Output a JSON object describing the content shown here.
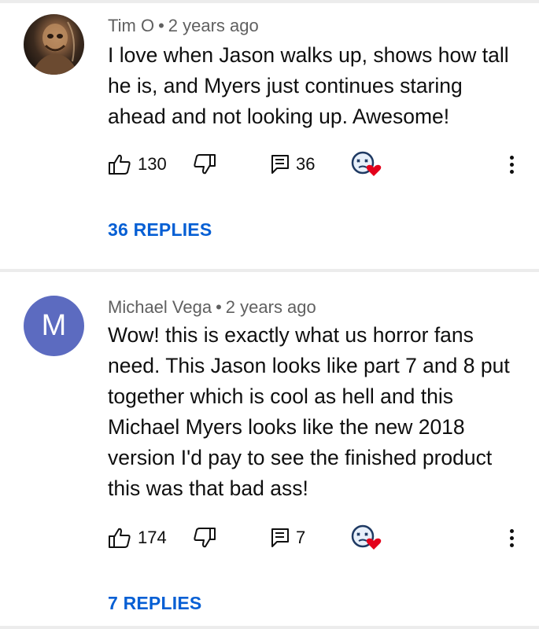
{
  "comments": [
    {
      "author": "Tim O",
      "separator": "•",
      "timestamp": "2 years ago",
      "text": "I love when Jason walks up, shows how tall he is, and Myers just continues staring ahead and not looking up.  Awesome!",
      "likes": "130",
      "reply_count": "36",
      "replies_label": "36 REPLIES",
      "avatar_icon": "horror-figure-photo"
    },
    {
      "author": "Michael Vega",
      "separator": "•",
      "timestamp": "2 years ago",
      "text": "Wow! this is exactly what us horror fans need. This Jason looks like part 7 and 8 put together which is cool as hell and this Michael Myers looks like the new 2018 version I'd pay to see the finished product this was that bad ass!",
      "likes": "174",
      "reply_count": "7",
      "replies_label": "7 REPLIES",
      "avatar_letter": "M",
      "avatar_color": "#5c6bc0"
    }
  ],
  "colors": {
    "link": "#065fd4",
    "meta": "#606060",
    "heart": "#e3001b"
  }
}
